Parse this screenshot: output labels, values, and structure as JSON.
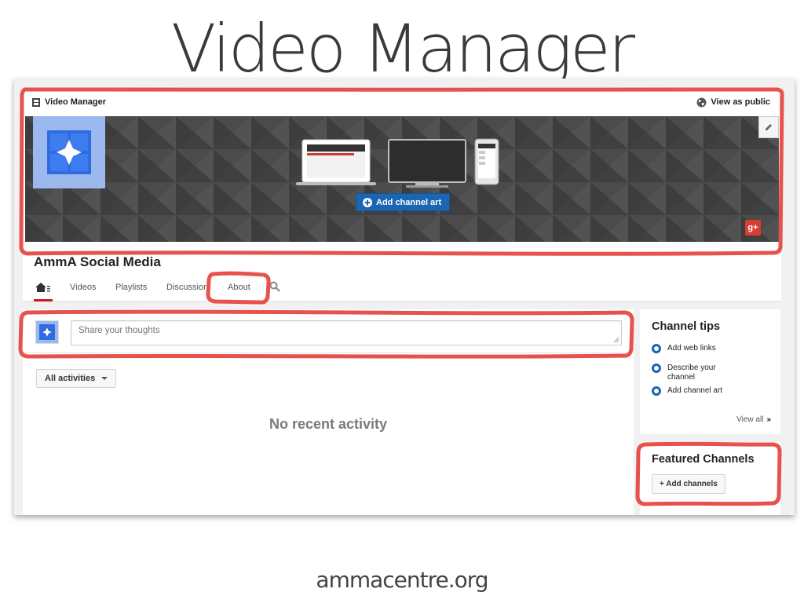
{
  "slide": {
    "title": "Video Manager",
    "footer": "ammacentre.org"
  },
  "header": {
    "video_manager_label": "Video Manager",
    "view_public_label": "View as public"
  },
  "banner": {
    "add_art_label": "Add channel art",
    "gplus_label": "g+"
  },
  "channel": {
    "name": "AmmA Social Media"
  },
  "tabs": [
    {
      "label": "Videos"
    },
    {
      "label": "Playlists"
    },
    {
      "label": "Discussion"
    },
    {
      "label": "About"
    }
  ],
  "feed": {
    "share_placeholder": "Share your thoughts",
    "filter_label": "All activities",
    "empty_message": "No recent activity"
  },
  "tips": {
    "title": "Channel tips",
    "items": [
      {
        "label": "Add web links"
      },
      {
        "label": "Describe your channel"
      },
      {
        "label": "Add channel art"
      }
    ],
    "view_all_label": "View all",
    "view_all_arrow": "»"
  },
  "featured": {
    "title": "Featured Channels",
    "add_label": "+ Add channels"
  },
  "colors": {
    "highlight": "#e8524d",
    "accent_blue": "#1b66b3",
    "youtube_red": "#cc181e"
  }
}
